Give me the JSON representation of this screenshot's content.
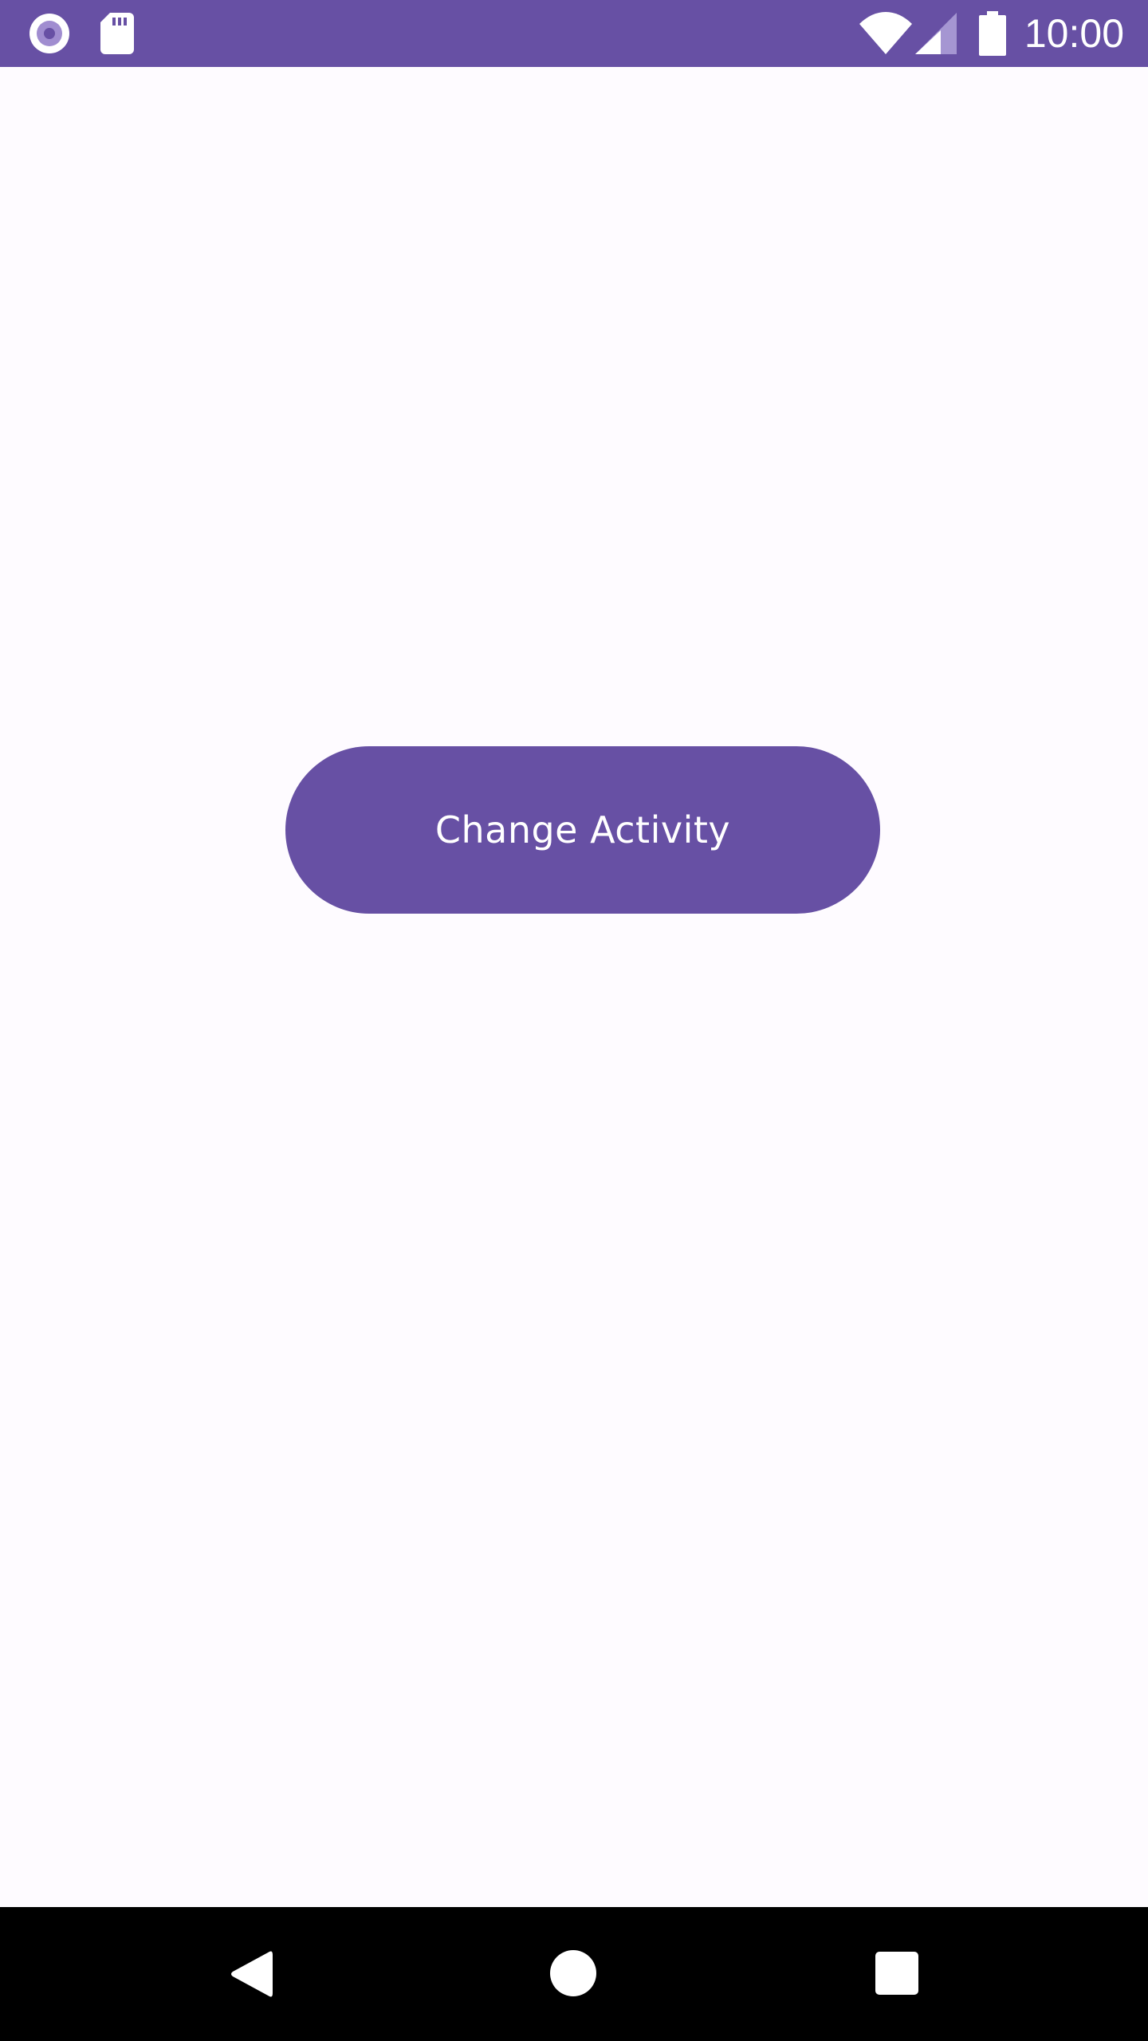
{
  "status_bar": {
    "time": "10:00",
    "background": "#6750A4",
    "left_icons": [
      "record-icon",
      "sd-card-icon"
    ],
    "right_icons": [
      "wifi-icon",
      "cellular-signal-icon",
      "battery-icon"
    ]
  },
  "main": {
    "background": "#FEFBFF",
    "button_label": "Change Activity",
    "button_color": "#6750A4"
  },
  "nav_bar": {
    "background": "#000000",
    "buttons": [
      "back-icon",
      "home-icon",
      "recents-icon"
    ]
  }
}
